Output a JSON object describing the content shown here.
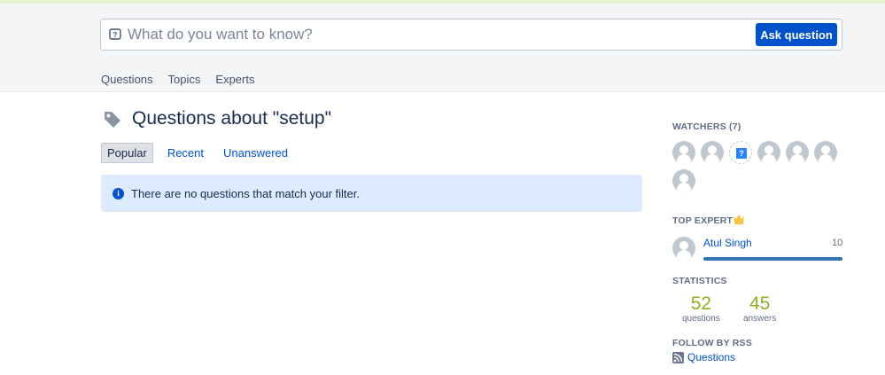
{
  "search": {
    "placeholder": "What do you want to know?",
    "ask_label": "Ask question"
  },
  "nav": {
    "items": [
      "Questions",
      "Topics",
      "Experts"
    ]
  },
  "page": {
    "title": "Questions about \"setup\""
  },
  "filters": {
    "items": [
      "Popular",
      "Recent",
      "Unanswered"
    ],
    "active": "Popular"
  },
  "info": {
    "message": "There are no questions that match your filter."
  },
  "sidebar": {
    "watchers_heading": "WATCHERS (7)",
    "top_expert_heading": "TOP EXPERT",
    "expert": {
      "name": "Atul Singh",
      "score": "10",
      "bar_fraction": 1.0
    },
    "statistics_heading": "STATISTICS",
    "stats": [
      {
        "value": "52",
        "label": "questions"
      },
      {
        "value": "45",
        "label": "answers"
      }
    ],
    "rss_heading": "FOLLOW BY RSS",
    "rss_link": "Questions"
  },
  "colors": {
    "accent": "#0052cc",
    "stat": "#8eb021",
    "info_bg": "#deebff",
    "crown": "#f6c342"
  }
}
